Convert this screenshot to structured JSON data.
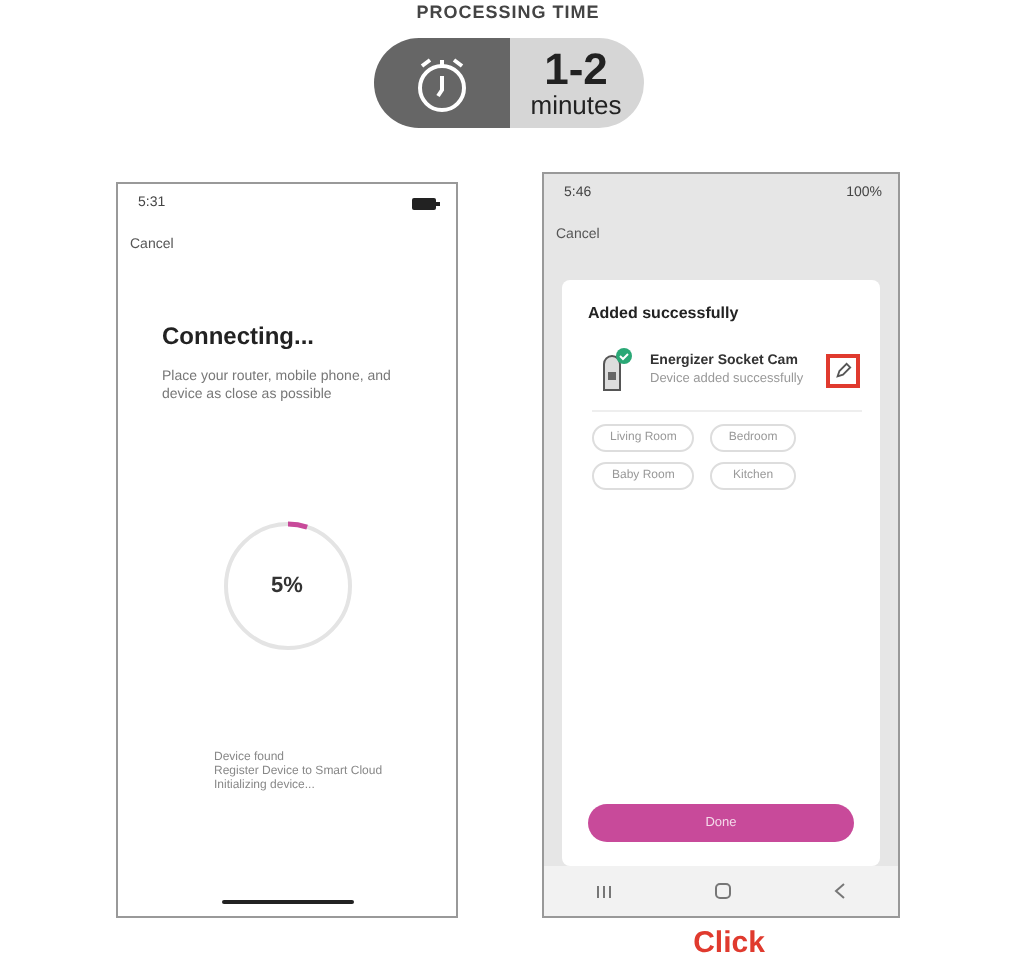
{
  "header": {
    "title": "PROCESSING TIME",
    "time_value": "1-2",
    "time_unit": "minutes"
  },
  "connecting_screen": {
    "status_time": "5:31",
    "cancel": "Cancel",
    "title": "Connecting...",
    "hint": "Place your router, mobile phone, and device as close as possible",
    "progress": {
      "level": 0.05,
      "reading": "5%"
    },
    "steps": [
      "Device found",
      "Register Device to Smart Cloud",
      "Initializing device..."
    ]
  },
  "added_screen": {
    "status_time": "5:46",
    "battery": "100%",
    "cancel": "Cancel",
    "title": "Added successfully",
    "device_name": "Energizer Socket Cam",
    "device_status": "Device added successfully",
    "rooms": [
      {
        "label": "Living Room",
        "selected": false
      },
      {
        "label": "Bedroom",
        "selected": false
      },
      {
        "label": "Baby Room",
        "selected": false
      },
      {
        "label": "Kitchen",
        "selected": false
      }
    ],
    "done": "Done"
  },
  "caption": "Click"
}
